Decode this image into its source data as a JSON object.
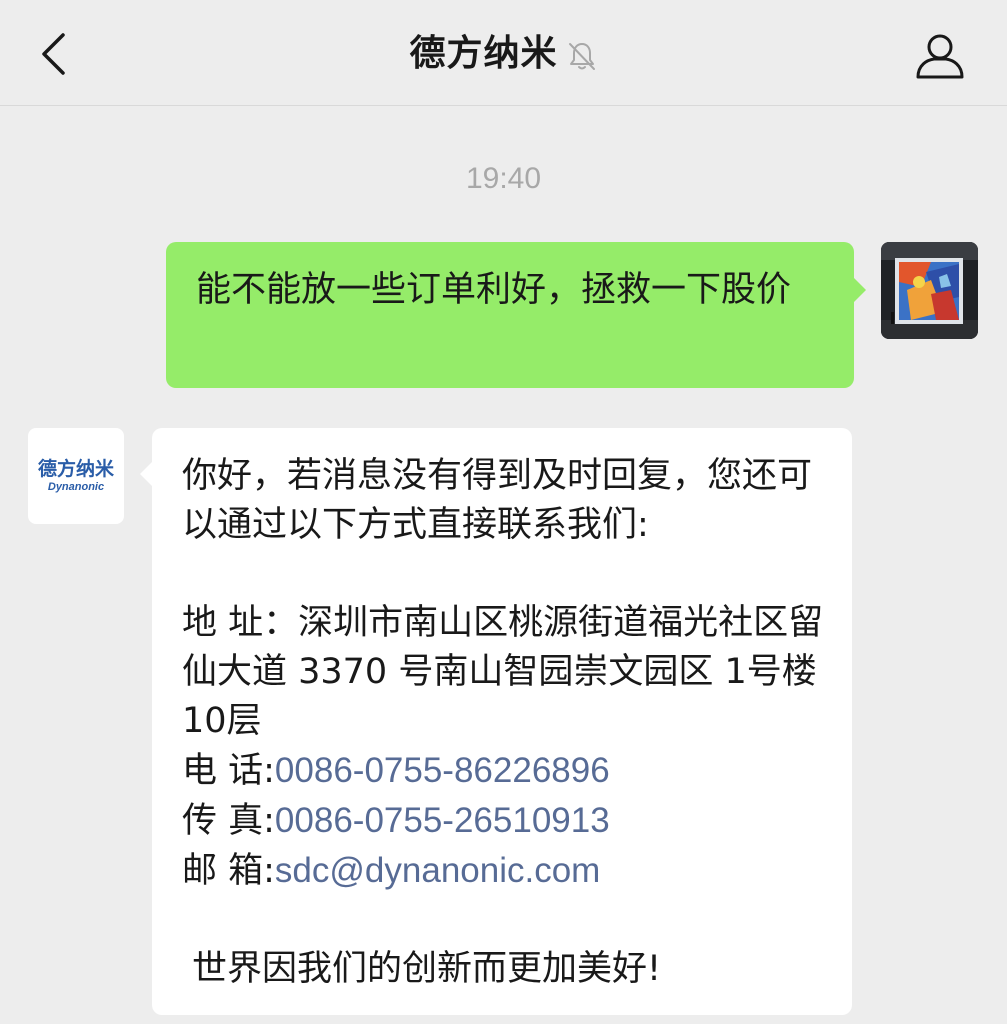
{
  "header": {
    "title": "德方纳米",
    "back_icon": "chevron-left-icon",
    "mute_icon": "bell-muted-icon",
    "profile_icon": "person-icon"
  },
  "chat": {
    "timestamp": "19:40",
    "outgoing_message": "能不能放一些订单利好，拯救一下股价",
    "incoming": {
      "intro": "你好，若消息没有得到及时回复，您还可以通过以下方式直接联系我们:",
      "address_label": "地 址：",
      "address_value": "深圳市南山区桃源街道福光社区留仙大道 3370 号南山智园崇文园区 1号楼 10层",
      "phone_label": "电 话:",
      "phone_value": "0086-0755-86226896",
      "fax_label": "传 真:",
      "fax_value": "0086-0755-26510913",
      "email_label": "邮 箱:",
      "email_value": "sdc@dynanonic.com",
      "slogan": "世界因我们的创新而更加美好!"
    },
    "sender_avatar": {
      "logo_cn": "德方纳米",
      "logo_en": "Dynanonic"
    }
  },
  "colors": {
    "background": "#ededed",
    "outgoing_bubble": "#95ec69",
    "incoming_bubble": "#ffffff",
    "link": "#576b95",
    "timestamp": "#a8a8a8"
  }
}
